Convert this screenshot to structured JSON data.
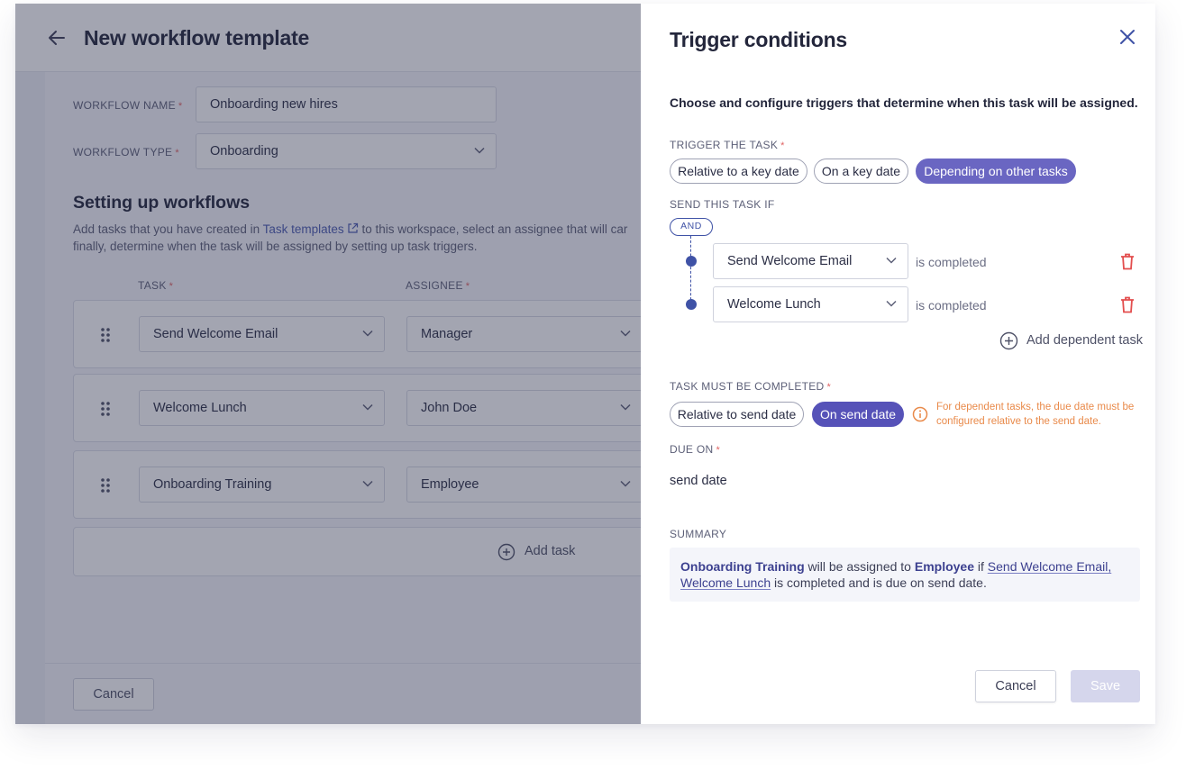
{
  "background_page": {
    "title": "New workflow template",
    "workflow_name": {
      "label": "WORKFLOW NAME",
      "required_mark": "*",
      "value": "Onboarding new hires"
    },
    "workflow_type": {
      "label": "WORKFLOW TYPE",
      "required_mark": "*",
      "value": "Onboarding"
    },
    "section_title": "Setting up workflows",
    "section_desc": {
      "before_link": "Add tasks that you have created in ",
      "link": "Task templates",
      "after_link": " to this workspace, select an assignee that will car",
      "line2": "finally, determine when the task will be assigned by setting up task triggers."
    },
    "columns": {
      "task": "TASK",
      "assignee": "ASSIGNEE",
      "required_mark": "*"
    },
    "rows": [
      {
        "task": "Send Welcome Email",
        "assignee": "Manager"
      },
      {
        "task": "Welcome Lunch",
        "assignee": "John Doe"
      },
      {
        "task": "Onboarding Training",
        "assignee": "Employee"
      }
    ],
    "add_task": "Add task",
    "cancel": "Cancel"
  },
  "drawer": {
    "title": "Trigger conditions",
    "intro": "Choose and configure triggers that determine when this task will be assigned.",
    "trigger_label": "TRIGGER THE TASK",
    "required_mark": "*",
    "trigger_options": [
      "Relative to a key date",
      "On a key date",
      "Depending on other tasks"
    ],
    "trigger_selected": "Depending on other tasks",
    "send_if_label": "SEND THIS TASK IF",
    "operator": "AND",
    "conditions": [
      {
        "task": "Send Welcome Email",
        "status": "is completed"
      },
      {
        "task": "Welcome Lunch",
        "status": "is completed"
      }
    ],
    "add_dependent": "Add dependent task",
    "completed_label": "TASK MUST BE COMPLETED",
    "completed_options": [
      "Relative to send date",
      "On send date"
    ],
    "completed_selected": "On send date",
    "warning": "For dependent tasks, the due date must be configured relative to the send date.",
    "due_label": "DUE ON",
    "due_value": "send date",
    "summary_label": "SUMMARY",
    "summary": {
      "task": "Onboarding Training",
      "t1": " will be assigned to ",
      "assignee": "Employee",
      "t2": " if ",
      "dep1": "Send Welcome Email,",
      "dep2": "Welcome Lunch",
      "t3": " is completed and is due on send date."
    },
    "cancel": "Cancel",
    "save": "Save"
  },
  "colors": {
    "accent": "#6a66c2",
    "accent_dark": "#5652b8",
    "tree": "#3f52a6",
    "warning": "#e98a4a",
    "danger": "#e34e4e",
    "overlay": "#2a2f4a"
  },
  "icons": [
    "back-arrow-icon",
    "chevron-down-icon",
    "external-link-icon",
    "drag-handle-icon",
    "plus-circle-icon",
    "close-icon",
    "trash-icon",
    "info-icon"
  ]
}
